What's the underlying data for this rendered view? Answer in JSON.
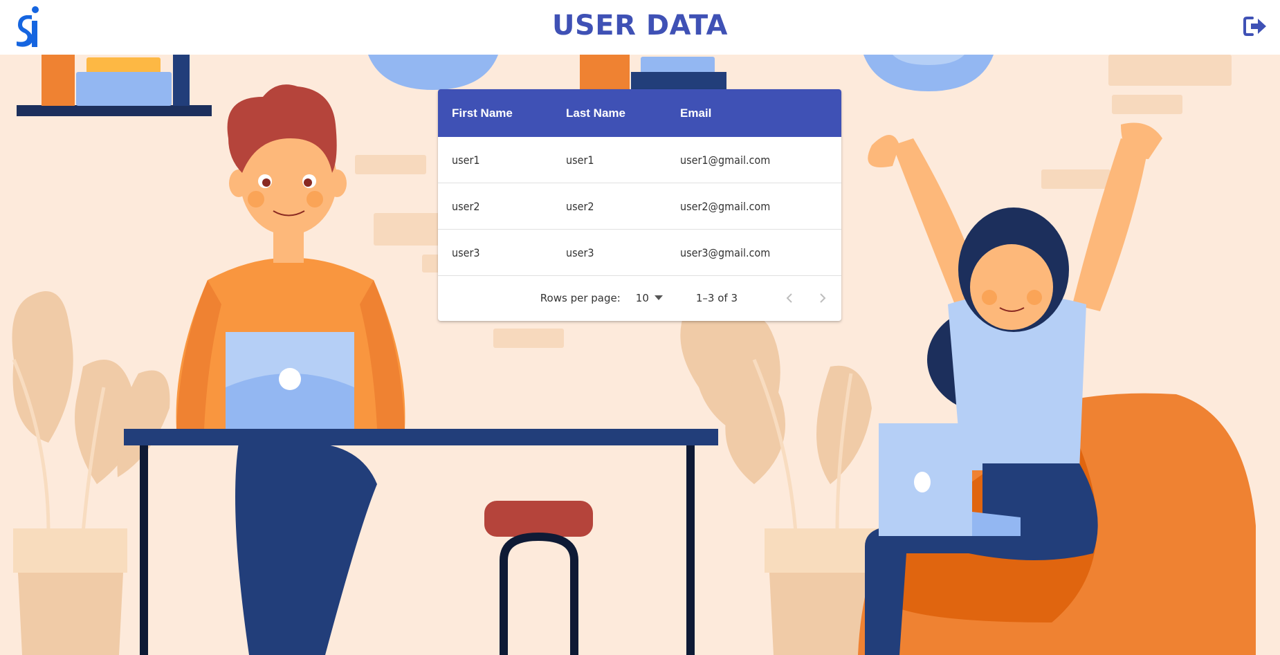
{
  "header": {
    "title": "USER DATA",
    "logo_icon": "brand-logo-icon",
    "logout_icon": "logout-icon"
  },
  "table": {
    "columns": [
      "First Name",
      "Last Name",
      "Email"
    ],
    "rows": [
      {
        "first": "user1",
        "last": "user1",
        "email": "user1@gmail.com"
      },
      {
        "first": "user2",
        "last": "user2",
        "email": "user2@gmail.com"
      },
      {
        "first": "user3",
        "last": "user3",
        "email": "user3@gmail.com"
      }
    ],
    "pagination": {
      "rows_per_page_label": "Rows per page:",
      "rows_per_page_value": "10",
      "range": "1–3 of 3",
      "prev_icon": "chevron-left-icon",
      "next_icon": "chevron-right-icon"
    }
  },
  "colors": {
    "primary": "#3f51b5",
    "background": "#fdeadb",
    "logo_blue": "#1565e0"
  }
}
